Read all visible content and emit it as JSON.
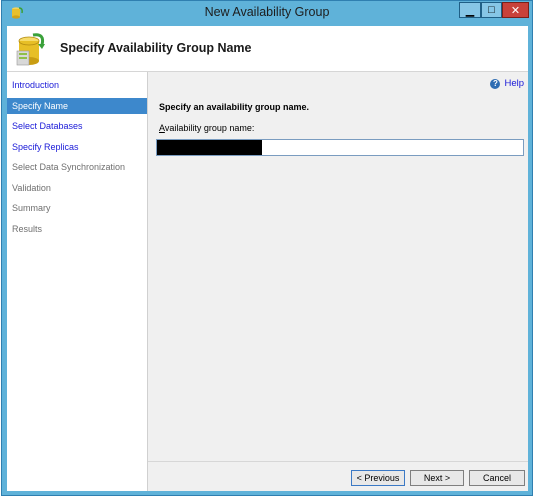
{
  "window": {
    "title": "New Availability Group"
  },
  "titlebar": {
    "min_glyph": "▁",
    "max_glyph": "□",
    "close_glyph": "✕"
  },
  "header": {
    "title": "Specify Availability Group Name"
  },
  "nav": {
    "items": [
      {
        "label": "Introduction",
        "state": "link"
      },
      {
        "label": "Specify Name",
        "state": "active"
      },
      {
        "label": "Select Databases",
        "state": "link"
      },
      {
        "label": "Specify Replicas",
        "state": "link"
      },
      {
        "label": "Select Data Synchronization",
        "state": "disabled"
      },
      {
        "label": "Validation",
        "state": "disabled"
      },
      {
        "label": "Summary",
        "state": "disabled"
      },
      {
        "label": "Results",
        "state": "disabled"
      }
    ]
  },
  "content": {
    "help_label": "Help",
    "help_icon_glyph": "?",
    "instruction": "Specify an availability group name.",
    "field_label_accel": "A",
    "field_label_rest": "vailability group name:",
    "field_value": ""
  },
  "buttons": {
    "previous": "< Previous",
    "next": "Next >",
    "cancel": "Cancel"
  },
  "colors": {
    "titlebar": "#5fb2d9",
    "active_nav": "#3d88cc",
    "link": "#1a1ad8",
    "close": "#c9413a"
  }
}
